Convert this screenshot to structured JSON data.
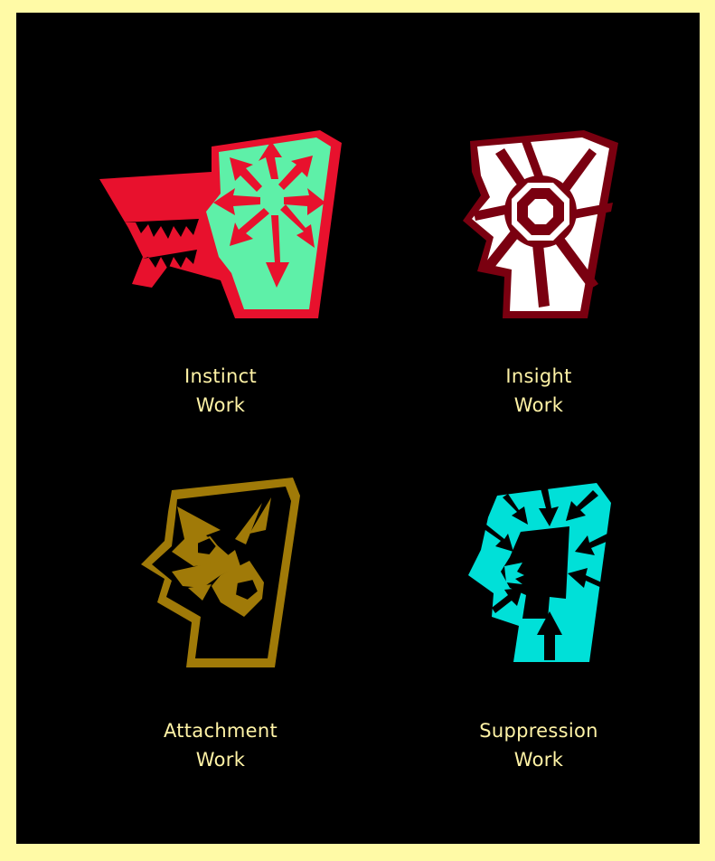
{
  "cards": [
    {
      "title_line1": "Instinct",
      "title_line2": "Work",
      "icon": "wolf-head-icon",
      "colors": {
        "outer": "#e8112d",
        "inner": "#5ef0a8"
      }
    },
    {
      "title_line1": "Insight",
      "title_line2": "Work",
      "icon": "eye-head-icon",
      "colors": {
        "outer": "#7a0010",
        "inner": "#ffffff"
      }
    },
    {
      "title_line1": "Attachment",
      "title_line2": "Work",
      "icon": "knot-head-icon",
      "colors": {
        "outer": "#a07a08",
        "inner": "#000000"
      }
    },
    {
      "title_line1": "Suppression",
      "title_line2": "Work",
      "icon": "pressed-head-icon",
      "colors": {
        "outer": "#00e0d8",
        "inner": "#000000"
      }
    }
  ]
}
